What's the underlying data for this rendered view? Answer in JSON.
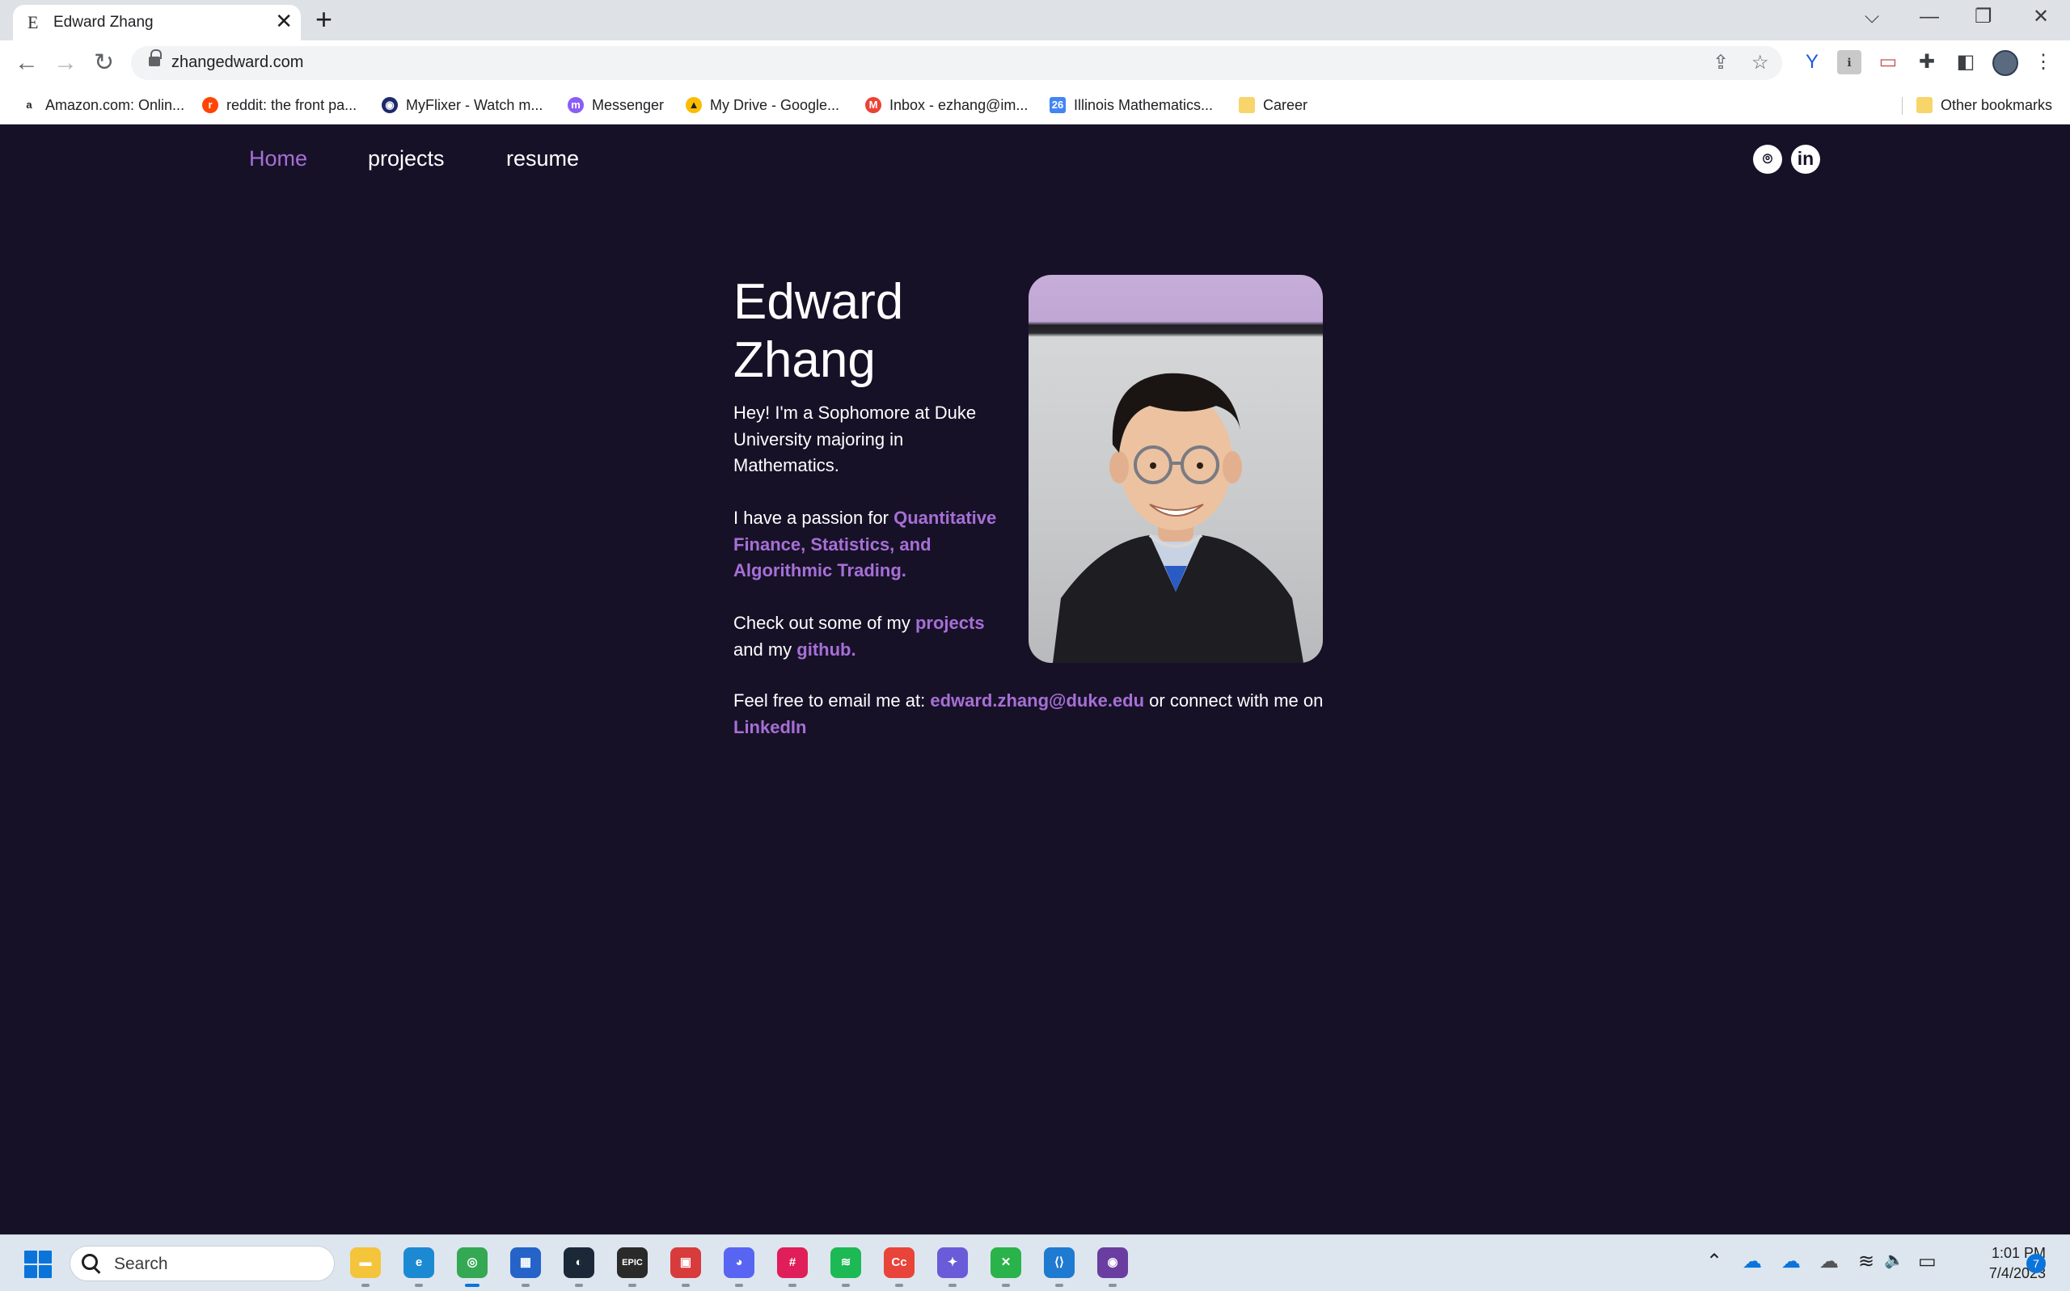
{
  "browser": {
    "tab_title": "Edward Zhang",
    "tab_favicon": "E",
    "tab_close": "✕",
    "new_tab": "+",
    "url": "zhangedward.com",
    "controls": {
      "tab_search": "⌵",
      "minimize": "—",
      "restore": "❐",
      "close": "✕"
    },
    "nav": {
      "back": "←",
      "forward": "→",
      "reload": "↻"
    },
    "omnibox_icons": {
      "share": "⇪",
      "star": "☆"
    },
    "bookmarks": [
      {
        "label": "Amazon.com: Onlin...",
        "icon": "amazon-icon",
        "glyph": "a",
        "color": "#ffffff"
      },
      {
        "label": "reddit: the front pa...",
        "icon": "reddit-icon",
        "glyph": "r",
        "color": "#ff4500"
      },
      {
        "label": "MyFlixer - Watch m...",
        "icon": "myflixer-icon",
        "glyph": "◉",
        "color": "#1c2a6b"
      },
      {
        "label": "Messenger",
        "icon": "messenger-icon",
        "glyph": "m",
        "color": "#8c5cf5"
      },
      {
        "label": "My Drive - Google...",
        "icon": "google-drive-icon",
        "glyph": "▲",
        "color": "#fbbc04"
      },
      {
        "label": "Inbox - ezhang@im...",
        "icon": "gmail-icon",
        "glyph": "M",
        "color": "#ea4335"
      },
      {
        "label": "Illinois Mathematics...",
        "icon": "calendar-icon",
        "glyph": "26",
        "color": "#4285f4"
      },
      {
        "label": "Career",
        "icon": "folder-icon",
        "glyph": "",
        "color": "#f7d56b"
      }
    ],
    "other_bookmarks": "Other bookmarks"
  },
  "site": {
    "nav": {
      "home": "Home",
      "projects": "projects",
      "resume": "resume"
    },
    "social": {
      "github_glyph": "⌾",
      "linkedin_glyph": "in"
    },
    "name_line1": "Edward",
    "name_line2": "Zhang",
    "intro": "Hey! I'm a Sophomore at Duke University majoring in Mathematics.",
    "passion_prefix": "I have a passion for ",
    "passion_highlight": "Quantitative Finance, Statistics, and Algorithmic Trading.",
    "check_prefix": "Check out some of my ",
    "check_projects": "projects",
    "check_middle": " and my ",
    "check_github": "github.",
    "contact_prefix": "Feel free to email me at: ",
    "contact_email": "edward.zhang@duke.edu",
    "contact_middle": " or connect with me on ",
    "contact_linkedin": "LinkedIn",
    "accent_color": "#a66fd6",
    "background_color": "#171127"
  },
  "taskbar": {
    "search_label": "Search",
    "apps": [
      {
        "name": "file-explorer-icon",
        "glyph": "▬",
        "color": "#f4c43a"
      },
      {
        "name": "edge-icon",
        "glyph": "e",
        "color": "#1b8ad3"
      },
      {
        "name": "chrome-icon",
        "glyph": "◎",
        "color": "#34a853"
      },
      {
        "name": "store-icon",
        "glyph": "▦",
        "color": "#2563c9"
      },
      {
        "name": "steam-icon",
        "glyph": "◐",
        "color": "#1b2838"
      },
      {
        "name": "epic-games-icon",
        "glyph": "EPIC",
        "color": "#2a2a2a"
      },
      {
        "name": "office-icon",
        "glyph": "▣",
        "color": "#d83b3b"
      },
      {
        "name": "discord-icon",
        "glyph": "◕",
        "color": "#5865f2"
      },
      {
        "name": "slack-icon",
        "glyph": "#",
        "color": "#e01e5a"
      },
      {
        "name": "spotify-icon",
        "glyph": "≋",
        "color": "#1db954"
      },
      {
        "name": "creative-cloud-icon",
        "glyph": "Cc",
        "color": "#e8443a"
      },
      {
        "name": "copilot-icon",
        "glyph": "✦",
        "color": "#6a5bd8"
      },
      {
        "name": "xbox-icon",
        "glyph": "✕",
        "color": "#2ab34a"
      },
      {
        "name": "vscode-icon",
        "glyph": "⟨⟩",
        "color": "#1f7ad1"
      },
      {
        "name": "github-desktop-icon",
        "glyph": "◉",
        "color": "#6a3ea1"
      }
    ],
    "tray": {
      "chevron": "⌃",
      "onedrive1": "☁",
      "onedrive2": "☁",
      "onedrive3": "☁",
      "wifi": "≋",
      "volume": "🔈",
      "battery": "▭"
    },
    "time": "1:01 PM",
    "date": "7/4/2023",
    "notification_count": "7"
  }
}
